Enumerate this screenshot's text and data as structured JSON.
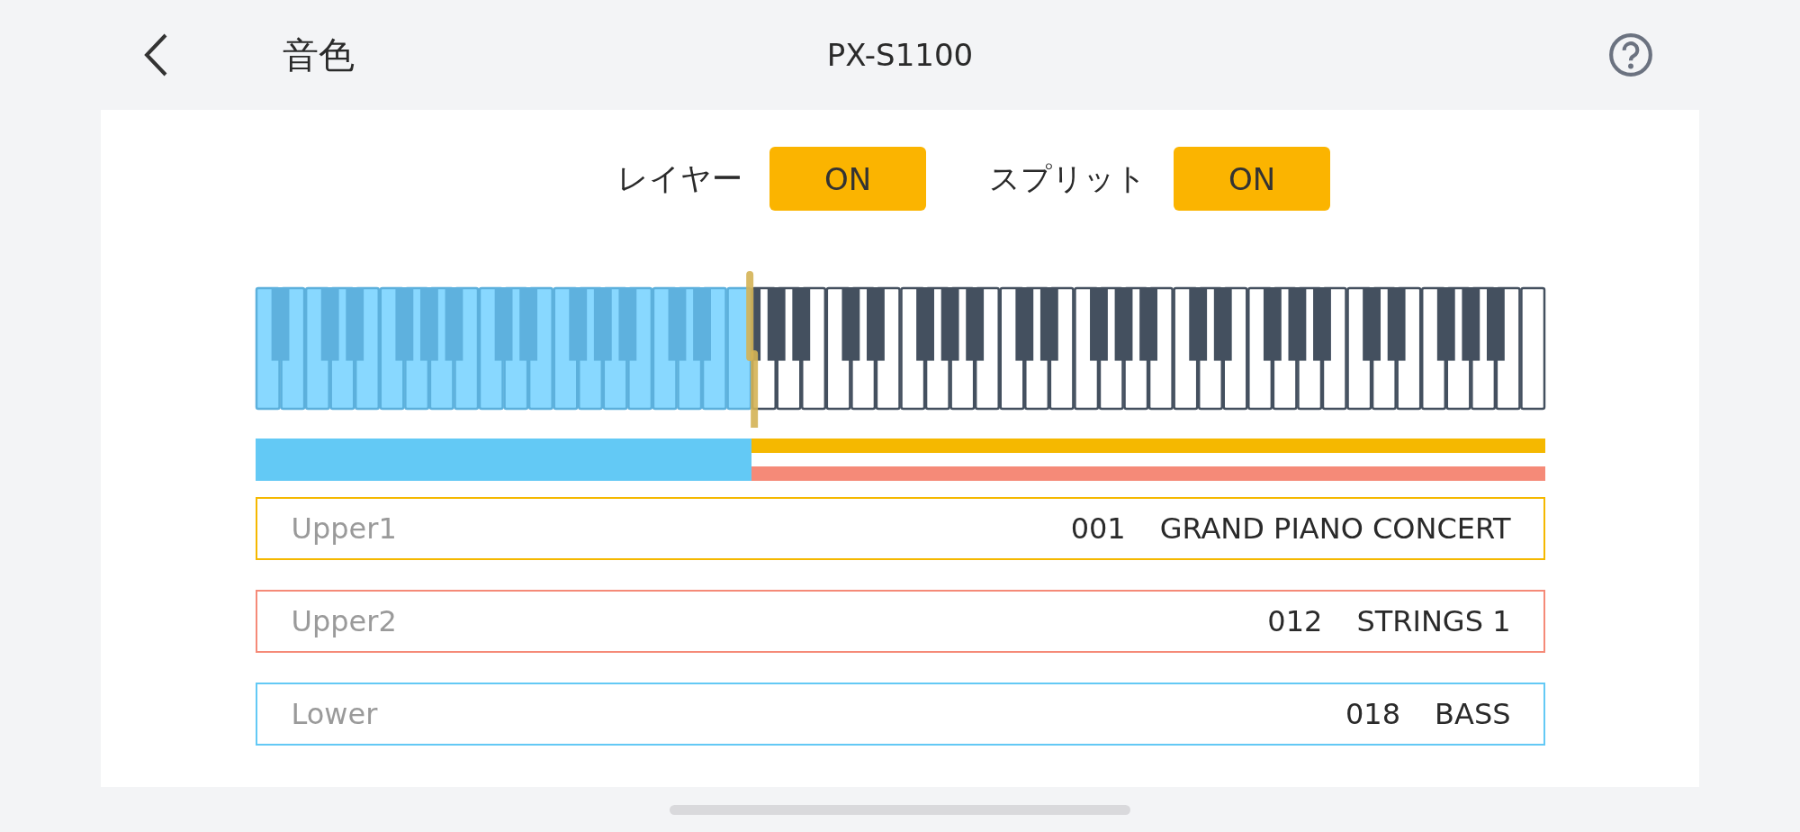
{
  "header": {
    "title": "音色",
    "device": "PX-S1100"
  },
  "toggles": [
    {
      "label": "レイヤー",
      "value": "ON",
      "on": true
    },
    {
      "label": "スプリット",
      "value": "ON",
      "on": true
    }
  ],
  "keyboard": {
    "split_point": {
      "level": 0.3846
    }
  },
  "parts": [
    {
      "name": "Upper1",
      "number": "001",
      "tone": "GRAND PIANO CONCERT",
      "color": "#f5b800",
      "kind": "upper"
    },
    {
      "name": "Upper2",
      "number": "012",
      "tone": "STRINGS 1",
      "color": "#f58a78",
      "kind": "upper"
    },
    {
      "name": "Lower",
      "number": "018",
      "tone": "BASS",
      "color": "#63c9f5",
      "kind": "lower"
    }
  ]
}
